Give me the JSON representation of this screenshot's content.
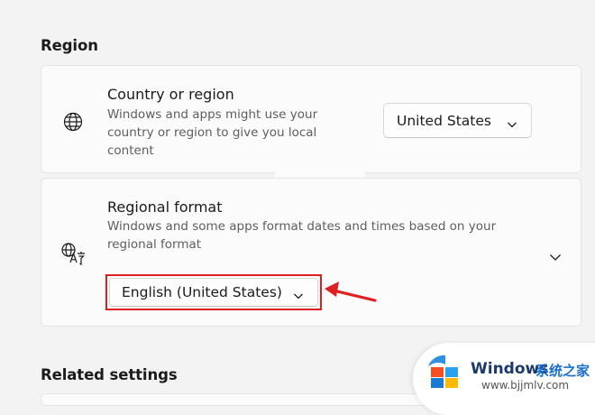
{
  "region": {
    "section_title": "Region",
    "country": {
      "title": "Country or region",
      "description": "Windows and apps might use your country or region to give you local content",
      "selected": "United States",
      "icon": "globe-icon"
    },
    "format": {
      "title": "Regional format",
      "description": "Windows and some apps format dates and times based on your regional format",
      "selected": "English (United States)",
      "icon": "language-icon"
    }
  },
  "related": {
    "section_title": "Related settings"
  },
  "watermark": {
    "brand": "Windows",
    "cn_text": "系统之家",
    "url": "www.bjjmlv.com"
  },
  "colors": {
    "highlight": "#e02020",
    "card": "#fbfbfb",
    "background": "#f3f3f3"
  }
}
